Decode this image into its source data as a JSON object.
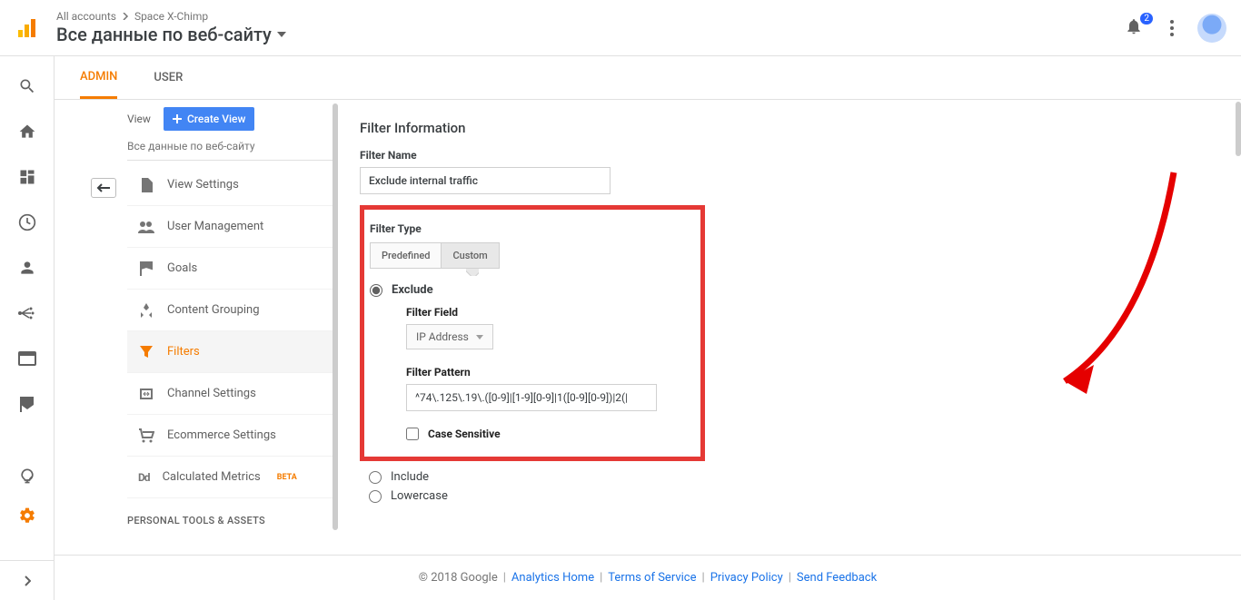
{
  "header": {
    "breadcrumb1": "All accounts",
    "breadcrumb2": "Space X-Chimp",
    "title": "Все данные по веб-сайту",
    "notification_count": "2"
  },
  "tabs": {
    "admin": "ADMIN",
    "user": "USER"
  },
  "view_col": {
    "label": "View",
    "create_btn": "Create View",
    "subtitle": "Все данные по веб-сайту",
    "items": {
      "view_settings": "View Settings",
      "user_management": "User Management",
      "goals": "Goals",
      "content_grouping": "Content Grouping",
      "filters": "Filters",
      "channel_settings": "Channel Settings",
      "ecommerce_settings": "Ecommerce Settings",
      "calculated_metrics": "Calculated Metrics",
      "beta": "BETA"
    },
    "section_title": "PERSONAL TOOLS & ASSETS"
  },
  "panel": {
    "title": "Filter Information",
    "filter_name_label": "Filter Name",
    "filter_name_value": "Exclude internal traffic",
    "filter_type_label": "Filter Type",
    "seg_predefined": "Predefined",
    "seg_custom": "Custom",
    "exclude_label": "Exclude",
    "filter_field_label": "Filter Field",
    "filter_field_value": "IP Address",
    "filter_pattern_label": "Filter Pattern",
    "filter_pattern_value": "^74\\.125\\.19\\.([0-9]|[1-9][0-9]|1([0-9][0-9])|2(|",
    "case_sensitive": "Case Sensitive",
    "include_label": "Include",
    "lowercase_label": "Lowercase"
  },
  "footer": {
    "copyright": "© 2018 Google",
    "analytics_home": "Analytics Home",
    "terms": "Terms of Service",
    "privacy": "Privacy Policy",
    "feedback": "Send Feedback"
  }
}
